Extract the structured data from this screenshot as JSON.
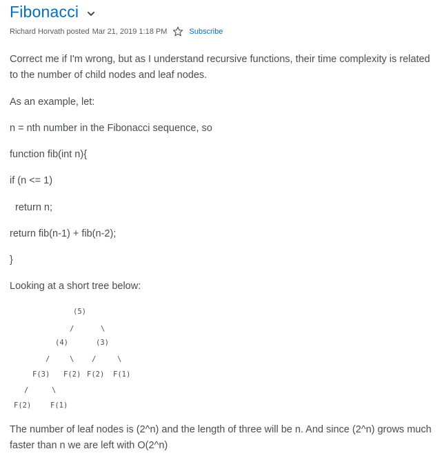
{
  "post": {
    "title": "Fibonacci",
    "author": "Richard Horvath posted",
    "date": "Mar 21, 2019 1:18 PM",
    "subscribe_label": "Subscribe"
  },
  "content": {
    "p1": "Correct me if I'm wrong, but as I understand recursive functions, their time complexity is related to the number of child nodes and leaf nodes.",
    "p2": "As an example, let:",
    "p3": "n = nth number in the Fibonacci sequence, so",
    "p4": "function fib(int n){",
    "p5": "if (n <= 1)",
    "p6": "return n;",
    "p7": "return fib(n-1) + fib(n-2);",
    "p8": "}",
    "p9": "Looking at a short tree below:",
    "p10": "The number of leaf nodes is (2^n) and the length of three will be n.  And since (2^n) grows much faster than n we are left with O(2^n)"
  },
  "tree": {
    "n5": "(5)",
    "n4": "(4)",
    "n3": "(3)",
    "f3": "F(3)",
    "f2a": "F(2)",
    "f2b": "F(2)",
    "f1a": "F(1)",
    "f2c": "F(2)",
    "f1b": "F(1)",
    "slash": "/",
    "backslash": "\\"
  },
  "colors": {
    "link": "#006fbf",
    "text": "#494c4e"
  },
  "icons": {
    "title_dropdown": "chevron-down-icon",
    "subscribe": "star-outline-icon"
  }
}
